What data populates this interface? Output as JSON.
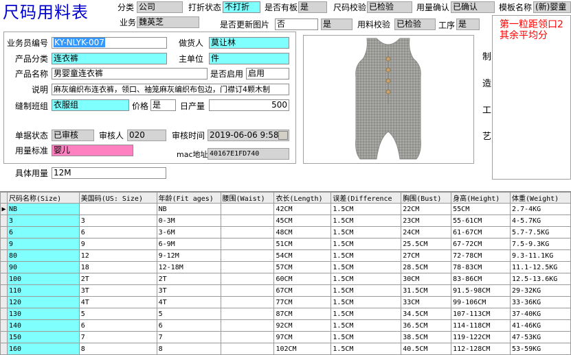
{
  "title": "尺码用料表",
  "header": {
    "category_label": "分类",
    "category_value": "公司",
    "discount_status_label": "打折状态",
    "discount_status_value": "不打折",
    "has_board_label": "是否有板",
    "has_board_value": "是",
    "size_check_label": "尺码校验",
    "size_check_value": "已检验",
    "usage_confirm_label": "用量确认",
    "usage_confirm_value": "已确认",
    "template_name_label": "模板名称",
    "template_name_value": "(新)婴童",
    "salesperson_label": "业务员",
    "salesperson_value": "魏英芝",
    "update_image_label": "是否更新图片",
    "update_image_value": "否",
    "update_image_value2": "是",
    "material_check_label": "用料校验",
    "material_check_value": "已检验",
    "process_label": "工序",
    "process_value": "是"
  },
  "notes_text": "第一粒距领口2\n其余平均分",
  "form": {
    "sales_no_label": "业务员编号",
    "sales_no_value": "KY-NLYK-007",
    "maker_label": "做货人",
    "maker_value": "莫让林",
    "product_category_label": "产品分类",
    "product_category_value": "连衣裤",
    "main_unit_label": "主单位",
    "main_unit_value": "件",
    "product_name_label": "产品名称",
    "product_name_value": "男婴童连衣裤",
    "enabled_label": "是否启用",
    "enabled_value": "启用",
    "description_label": "说明",
    "description_value": "麻灰编织布连衣裤，领口、袖笼麻灰编织布包边，门襟订4颗木制",
    "sewing_team_label": "缝制班组",
    "sewing_team_value": "衣服组",
    "price_label": "价格",
    "price_value": "是",
    "daily_output_label": "日产量",
    "daily_output_value": "500",
    "doc_status_label": "单据状态",
    "doc_status_value": "已审核",
    "reviewer_label": "审核人",
    "reviewer_value": "020",
    "review_time_label": "审核时间",
    "review_time_value": "2019-06-06 9:58:",
    "usage_std_label": "用量标准",
    "usage_std_value": "婴儿",
    "mac_label": "mac地址",
    "mac_value": "40167E1FD740",
    "specific_usage_label": "具体用量",
    "specific_usage_value": "12M"
  },
  "vertical_label": [
    "制",
    "造",
    "工",
    "艺"
  ],
  "table": {
    "columns": [
      "尺码名称(Size)",
      "美国码(US: Size)",
      "年龄(Fit ages)",
      "腰围(Waist)",
      "衣长(Length)",
      "误差(Difference",
      "胸围(Bust)",
      "身高(Height)",
      "体重(Weight)"
    ],
    "rows": [
      [
        "NB",
        "",
        "NB",
        "",
        "42CM",
        "1.5CM",
        "22CM",
        "55CM",
        "2.7-4KG"
      ],
      [
        "3",
        "3",
        "0-3M",
        "",
        "45CM",
        "1.5CM",
        "23CM",
        "55-61CM",
        "4-5.7KG"
      ],
      [
        "6",
        "6",
        "3-6M",
        "",
        "48CM",
        "1.5CM",
        "24CM",
        "61-67CM",
        "5.7-7.5KG"
      ],
      [
        "9",
        "9",
        "6-9M",
        "",
        "51CM",
        "1.5CM",
        "25.5CM",
        "67-72CM",
        "7.5-9.3KG"
      ],
      [
        "80",
        "12",
        "9-12M",
        "",
        "54CM",
        "1.5CM",
        "27CM",
        "72-78CM",
        "9.3-11.1KG"
      ],
      [
        "90",
        "18",
        "12-18M",
        "",
        "57CM",
        "1.5CM",
        "28.5CM",
        "78-83CM",
        "11.1-12.5KG"
      ],
      [
        "100",
        "2T",
        "2T",
        "",
        "60CM",
        "1.5CM",
        "30CM",
        "83-86CM",
        "12.5-13.6KG"
      ],
      [
        "110",
        "3T",
        "3T",
        "",
        "67CM",
        "1.5CM",
        "31.5CM",
        "91.5-98CM",
        "29-32KG"
      ],
      [
        "120",
        "4T",
        "4T",
        "",
        "77CM",
        "1.5CM",
        "33CM",
        "99-106CM",
        "33-36KG"
      ],
      [
        "130",
        "5",
        "5",
        "",
        "87CM",
        "1.5CM",
        "34.5CM",
        "107-113CM",
        "37-40KG"
      ],
      [
        "140",
        "6",
        "6",
        "",
        "92CM",
        "1.5CM",
        "36.5CM",
        "114-118CM",
        "41-46KG"
      ],
      [
        "150",
        "7",
        "7",
        "",
        "97CM",
        "1.5CM",
        "38.5CM",
        "119-122CM",
        "47-53KG"
      ],
      [
        "160",
        "8",
        "8",
        "",
        "102CM",
        "1.5CM",
        "40.5CM",
        "112-128CM",
        "53-59KG"
      ]
    ]
  },
  "colors": {
    "cyan": "#80ffff",
    "pink": "#ff80c0",
    "gray": "#d4d4d4",
    "title": "#0000cc",
    "note": "#ff0000"
  }
}
